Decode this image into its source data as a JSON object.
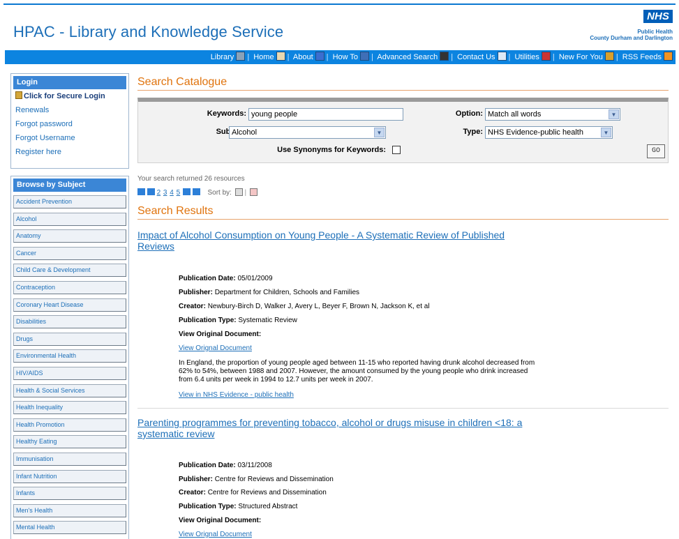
{
  "header": {
    "site_title": "HPAC - Library and Knowledge Service",
    "nhs_logo": "NHS",
    "org_line1": "Public Health",
    "org_line2": "County Durham and Darlington"
  },
  "nav": {
    "items": [
      {
        "label": "Library",
        "icon": "library-icon"
      },
      {
        "label": "Home",
        "icon": "home-icon"
      },
      {
        "label": "About",
        "icon": "info-icon"
      },
      {
        "label": "How To",
        "icon": "help-icon"
      },
      {
        "label": "Advanced Search",
        "icon": "binoculars-icon"
      },
      {
        "label": "Contact Us",
        "icon": "mail-icon"
      },
      {
        "label": "Utilities",
        "icon": "tools-icon"
      },
      {
        "label": "New For You",
        "icon": "new-icon"
      },
      {
        "label": "RSS Feeds",
        "icon": "rss-icon"
      }
    ]
  },
  "login": {
    "heading": "Login",
    "secure_login": "Click for Secure Login",
    "links": [
      "Renewals",
      "Forgot password",
      "Forgot Username",
      "Register here"
    ]
  },
  "browse": {
    "heading": "Browse by Subject",
    "subjects": [
      "Accident Prevention",
      "Alcohol",
      "Anatomy",
      "Cancer",
      "Child Care & Development",
      "Contraception",
      "Coronary Heart Disease",
      "Disabilities",
      "Drugs",
      "Environmental Health",
      "HIV/AIDS",
      "Health & Social Services",
      "Health Inequality",
      "Health Promotion",
      "Healthy Eating",
      "Immunisation",
      "Infant Nutrition",
      "Infants",
      "Men's Health",
      "Mental Health"
    ]
  },
  "search": {
    "section_title": "Search Catalogue",
    "keywords_label": "Keywords:",
    "keywords_value": "young people",
    "subject_label": "Subject:",
    "subject_value": "Alcohol",
    "option_label": "Option:",
    "option_value": "Match all words",
    "type_label": "Type:",
    "type_value": "NHS Evidence-public health",
    "synonyms_label": "Use Synonyms for Keywords:",
    "synonyms_checked": false,
    "go_label": "GO"
  },
  "results": {
    "count_text": "Your search returned 26 resources",
    "pages": [
      "2",
      "3",
      "4",
      "5"
    ],
    "sort_label": "Sort by:",
    "section_title": "Search Results",
    "items": [
      {
        "title": "Impact of Alcohol Consumption on Young People - A Systematic Review of Published Reviews",
        "pub_date_label": "Publication Date:",
        "pub_date": "05/01/2009",
        "publisher_label": "Publisher:",
        "publisher": "Department for Children, Schools and Families",
        "creator_label": "Creator:",
        "creator": "Newbury-Birch D, Walker J, Avery L, Beyer F, Brown N, Jackson K, et al",
        "pub_type_label": "Publication Type:",
        "pub_type": "Systematic Review",
        "view_label": "View Original Document:",
        "view_link": "View Orignal Document",
        "abstract": "In England, the proportion of young people aged between 11-15 who reported having drunk alcohol decreased from 62% to 54%, between 1988 and 2007. However, the amount consumed by the young people who drink increased from 6.4 units per week in 1994 to 12.7 units per week in 2007.",
        "evidence_link": "View in NHS Evidence - public health"
      },
      {
        "title": "Parenting programmes for preventing tobacco, alcohol or drugs misuse in children <18: a systematic review",
        "pub_date_label": "Publication Date:",
        "pub_date": "03/11/2008",
        "publisher_label": "Publisher:",
        "publisher": "Centre for Reviews and Dissemination",
        "creator_label": "Creator:",
        "creator": "Centre for Reviews and Dissemination",
        "pub_type_label": "Publication Type:",
        "pub_type": "Structured Abstract",
        "view_label": "View Original Document:",
        "view_link": "View Orignal Document"
      }
    ]
  }
}
